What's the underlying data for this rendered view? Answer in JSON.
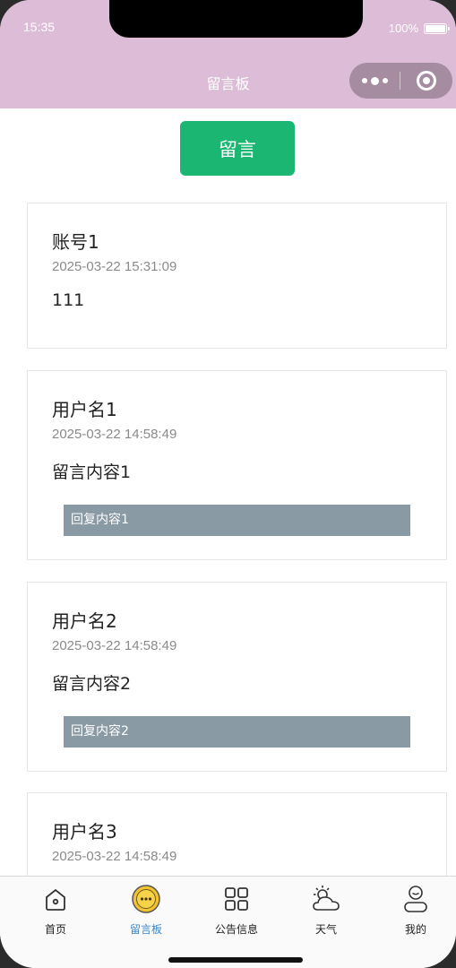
{
  "status_bar": {
    "time": "15:35",
    "battery": "100%"
  },
  "nav": {
    "title": "留言板"
  },
  "main": {
    "post_button": "留言",
    "messages": [
      {
        "author": "账号1",
        "time": "2025-03-22 15:31:09",
        "content": "111",
        "reply": ""
      },
      {
        "author": "用户名1",
        "time": "2025-03-22 14:58:49",
        "content": "留言内容1",
        "reply": "回复内容1"
      },
      {
        "author": "用户名2",
        "time": "2025-03-22 14:58:49",
        "content": "留言内容2",
        "reply": "回复内容2"
      },
      {
        "author": "用户名3",
        "time": "2025-03-22 14:58:49",
        "content": "",
        "reply": ""
      }
    ]
  },
  "tabbar": {
    "items": [
      {
        "label": "首页",
        "icon": "home-icon"
      },
      {
        "label": "留言板",
        "icon": "message-icon",
        "active": true
      },
      {
        "label": "公告信息",
        "icon": "grid-icon"
      },
      {
        "label": "天气",
        "icon": "weather-icon"
      },
      {
        "label": "我的",
        "icon": "profile-icon"
      }
    ]
  },
  "colors": {
    "header": "#dcbcd6",
    "accent": "#1cb673",
    "reply_bg": "#8a9aa4",
    "active_tab": "#3a86c8"
  }
}
